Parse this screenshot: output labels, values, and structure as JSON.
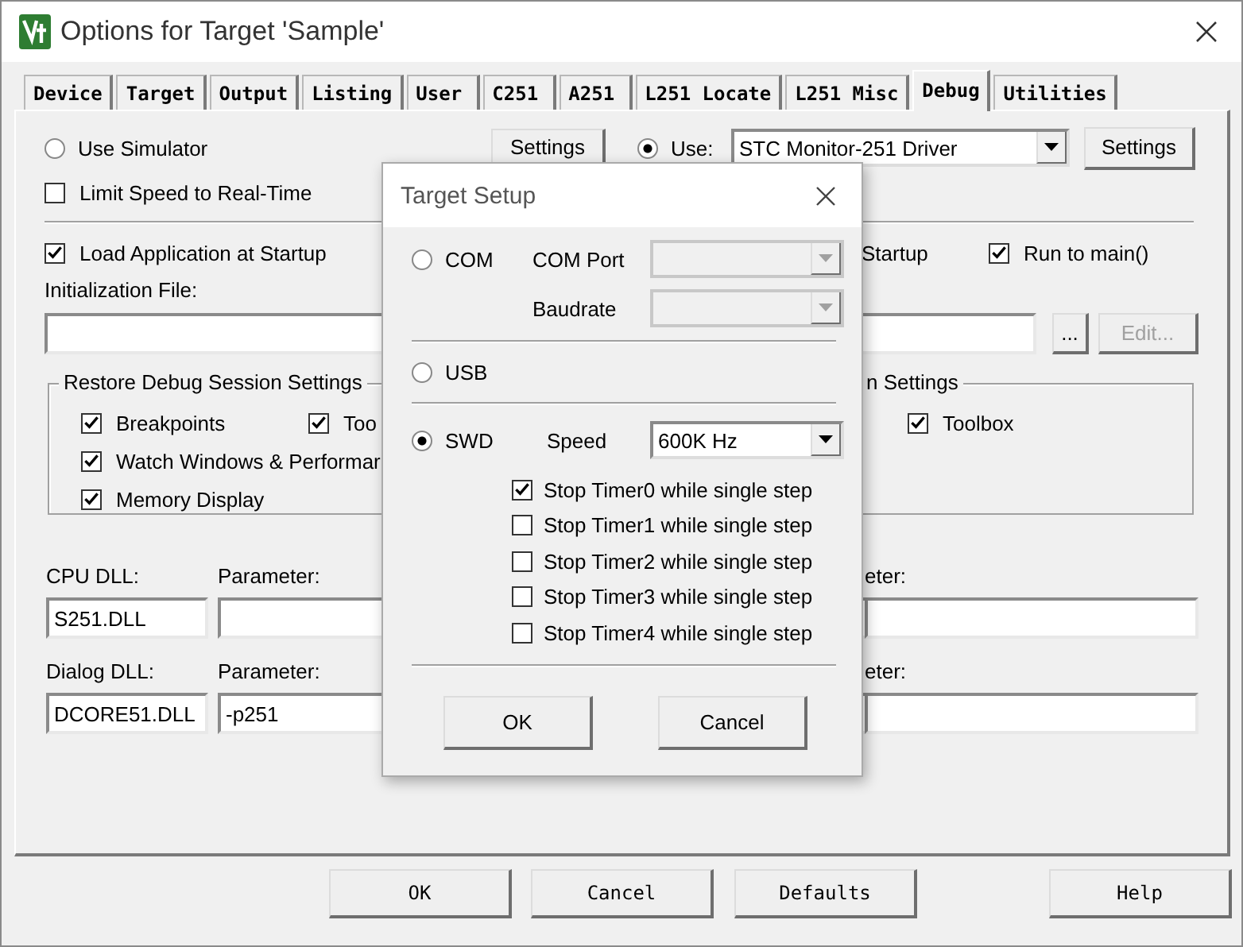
{
  "window": {
    "title": "Options for Target 'Sample'"
  },
  "tabs": [
    {
      "label": "Device",
      "selected": false
    },
    {
      "label": "Target",
      "selected": false
    },
    {
      "label": "Output",
      "selected": false
    },
    {
      "label": "Listing",
      "selected": false
    },
    {
      "label": "User",
      "selected": false
    },
    {
      "label": "C251",
      "selected": false
    },
    {
      "label": "A251",
      "selected": false
    },
    {
      "label": "L251 Locate",
      "selected": false
    },
    {
      "label": "L251 Misc",
      "selected": false
    },
    {
      "label": "Debug",
      "selected": true
    },
    {
      "label": "Utilities",
      "selected": false
    }
  ],
  "debug_modes": [
    {
      "label": "Use Simulator",
      "selected": false
    },
    {
      "label": "Use:",
      "selected": true
    }
  ],
  "simulator_settings_button": "Settings",
  "driver": {
    "value": "STC Monitor-251 Driver"
  },
  "driver_settings_button": "Settings",
  "limit_speed": {
    "label": "Limit Speed to Real-Time",
    "checked": false
  },
  "load_application": {
    "label": "Load Application at Startup",
    "checked": true
  },
  "load_application_right": {
    "label": "Startup"
  },
  "run_to_main": {
    "label": "Run to main()",
    "checked": true
  },
  "initialization_file": {
    "label": "Initialization File:"
  },
  "browse_button": "...",
  "edit_button": {
    "label": "Edit...",
    "disabled": true
  },
  "restore_group": {
    "title": "Restore Debug Session Settings",
    "options": [
      {
        "label": "Breakpoints",
        "checked": true
      },
      {
        "label": "Too",
        "checked": true
      },
      {
        "label": "Watch Windows & Performar",
        "checked": true
      },
      {
        "label": "Memory Display",
        "checked": true
      }
    ]
  },
  "restore_group_right": {
    "title": "n Settings",
    "options": [
      {
        "label": "Toolbox",
        "checked": true
      }
    ]
  },
  "cpu_dll": {
    "label": "CPU DLL:",
    "value": "S251.DLL",
    "parameter_label": "Parameter:",
    "right_parameter_label": "eter:"
  },
  "dialog_dll": {
    "label": "Dialog DLL:",
    "value": "DCORE51.DLL",
    "parameter_label": "Parameter:",
    "parameter_value": "-p251",
    "right_parameter_label": "eter:"
  },
  "buttons": [
    "OK",
    "Cancel",
    "Defaults",
    "Help"
  ],
  "target_setup": {
    "title": "Target Setup",
    "interfaces": [
      {
        "label": "COM",
        "selected": false
      },
      {
        "label": "USB",
        "selected": false
      },
      {
        "label": "SWD",
        "selected": true
      }
    ],
    "com_port": {
      "label": "COM Port",
      "disabled": true
    },
    "baudrate": {
      "label": "Baudrate",
      "disabled": true
    },
    "speed": {
      "label": "Speed",
      "value": "600K Hz"
    },
    "stop_timers": [
      {
        "label": "Stop Timer0 while single step",
        "checked": true
      },
      {
        "label": "Stop Timer1 while single step",
        "checked": false
      },
      {
        "label": "Stop Timer2 while single step",
        "checked": false
      },
      {
        "label": "Stop Timer3 while single step",
        "checked": false
      },
      {
        "label": "Stop Timer4 while single step",
        "checked": false
      }
    ],
    "buttons": [
      "OK",
      "Cancel"
    ]
  }
}
